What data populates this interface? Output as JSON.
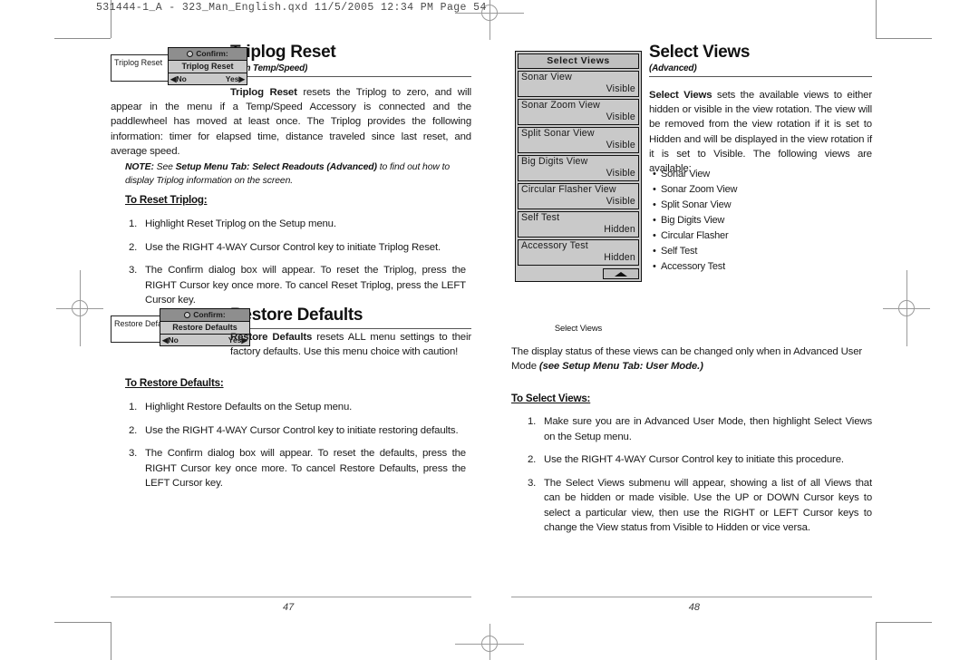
{
  "slug": "531444-1_A - 323_Man_English.qxd   11/5/2005   12:34 PM   Page 54",
  "left_page": {
    "folio": "47",
    "triplog": {
      "heading": "Triplog Reset",
      "subheading": "(with Temp/Speed)",
      "widget": {
        "menu_item_label": "Triplog Reset",
        "confirm_header": "Confirm:",
        "confirm_item": "Triplog Reset",
        "no_label": "No",
        "yes_label": "Yes",
        "left_arrow": "◀",
        "right_arrow": "▶"
      },
      "body_lead": "Triplog Reset",
      "body_text": " resets the Triplog to zero, and will appear in the menu if a Temp/Speed Accessory is connected and the paddlewheel has moved at least once. The Triplog provides the following information: timer for elapsed time, distance traveled since last reset, and average speed.",
      "note_label": "NOTE:",
      "note_ref": "Setup Menu Tab: Select Readouts (Advanced)",
      "note_pre": " See ",
      "note_post": " to find out how to display Triplog information on the screen.",
      "procedure_title": "To Reset Triplog:",
      "steps": [
        {
          "num": "1.",
          "text": "Highlight Reset Triplog on the Setup menu."
        },
        {
          "num": "2.",
          "text": "Use the RIGHT 4-WAY Cursor Control key to initiate Triplog Reset."
        },
        {
          "num": "3.",
          "text": "The Confirm dialog box will appear. To reset the Triplog, press the RIGHT Cursor key once more. To cancel Reset Triplog, press the LEFT Cursor key."
        }
      ]
    },
    "restore": {
      "heading": "Restore Defaults",
      "widget": {
        "menu_item_label": "Restore Defaults",
        "confirm_header": "Confirm:",
        "confirm_item": "Restore Defaults",
        "no_label": "No",
        "yes_label": "Yes",
        "left_arrow": "◀",
        "right_arrow": "▶"
      },
      "body_lead": "Restore Defaults",
      "body_text": " resets ALL menu settings to their factory defaults. Use this menu choice with caution!",
      "procedure_title": "To Restore Defaults:",
      "steps": [
        {
          "num": "1.",
          "text": "Highlight Restore Defaults on the Setup menu."
        },
        {
          "num": "2.",
          "text": "Use the RIGHT 4-WAY Cursor Control key to initiate restoring defaults."
        },
        {
          "num": "3.",
          "text": "The Confirm dialog box will appear. To reset the defaults,  press the RIGHT Cursor key once more. To cancel Restore Defaults, press the LEFT Cursor key."
        }
      ]
    }
  },
  "right_page": {
    "folio": "48",
    "heading": "Select Views",
    "subheading": "(Advanced)",
    "body_lead": "Select Views",
    "body_text": " sets the available views to either hidden or visible in the view rotation.  The view will be removed from the view rotation if it is set to Hidden and will be displayed in the view rotation if it is set to Visible. The following views are available:",
    "views_list": [
      "Sonar View",
      "Sonar Zoom View",
      "Split Sonar View",
      "Big Digits View",
      "Circular Flasher",
      "Self Test",
      "Accessory Test"
    ],
    "bullet": "•",
    "menu": {
      "title": "Select Views",
      "rows": [
        {
          "label": "Sonar View",
          "value": "Visible"
        },
        {
          "label": "Sonar Zoom View",
          "value": "Visible"
        },
        {
          "label": "Split Sonar View",
          "value": "Visible"
        },
        {
          "label": "Big Digits View",
          "value": "Visible"
        },
        {
          "label": "Circular Flasher View",
          "value": "Visible"
        },
        {
          "label": "Self Test",
          "value": "Hidden"
        },
        {
          "label": "Accessory Test",
          "value": "Hidden"
        }
      ]
    },
    "caption": "Select Views",
    "mode_note_plain": "The display status of these views can be changed only when in Advanced User Mode ",
    "mode_note_bold": "(see Setup Menu Tab: User Mode.)",
    "procedure_title": "To Select Views:",
    "steps": [
      {
        "num": "1.",
        "text": "Make sure you are in Advanced User Mode, then highlight Select Views on the Setup menu."
      },
      {
        "num": "2.",
        "text": "Use the RIGHT 4-WAY Cursor Control key to initiate this procedure."
      },
      {
        "num": "3.",
        "text": "The Select Views submenu will appear, showing a list of all Views that can be hidden or made visible. Use the UP or DOWN Cursor keys to select a particular view, then use the RIGHT or LEFT Cursor keys to change the View status from Visible to Hidden or vice versa."
      }
    ]
  }
}
